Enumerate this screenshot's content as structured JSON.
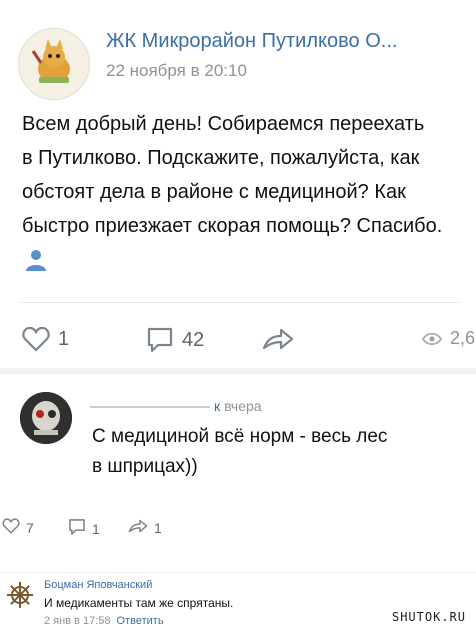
{
  "post": {
    "title": "ЖК Микрорайон Путилково О...",
    "date": "22 ноября в 20:10",
    "text": "Всем добрый день! Собираемся переехать\nв Путилково. Подскажите, пожалуйста, как\nобстоят дела в районе с медициной? Как\nбыстро приезжает скорая помощь? Спасибо.",
    "likes": "1",
    "comments": "42",
    "views": "2,6",
    "icons": {
      "like": "heart-icon",
      "comment": "comment-icon",
      "share": "share-arrow-icon",
      "views": "eye-icon",
      "author": "person-icon"
    }
  },
  "comment": {
    "author_suffix": "к",
    "time": "вчера",
    "text": "С медициной всё норм - весь лес\nв шприцах))",
    "likes": "7",
    "replies": "1",
    "shares": "1"
  },
  "reply": {
    "author": "Боцман Яповчанский",
    "text": "И медикаменты там же спрятаны.",
    "time": "2 янв в 17:58",
    "reply_label": "Ответить",
    "watermark": "SHUTOK.RU"
  },
  "colors": {
    "link": "#3a6ea5",
    "muted": "#8d9399",
    "icon": "#5b6570"
  }
}
